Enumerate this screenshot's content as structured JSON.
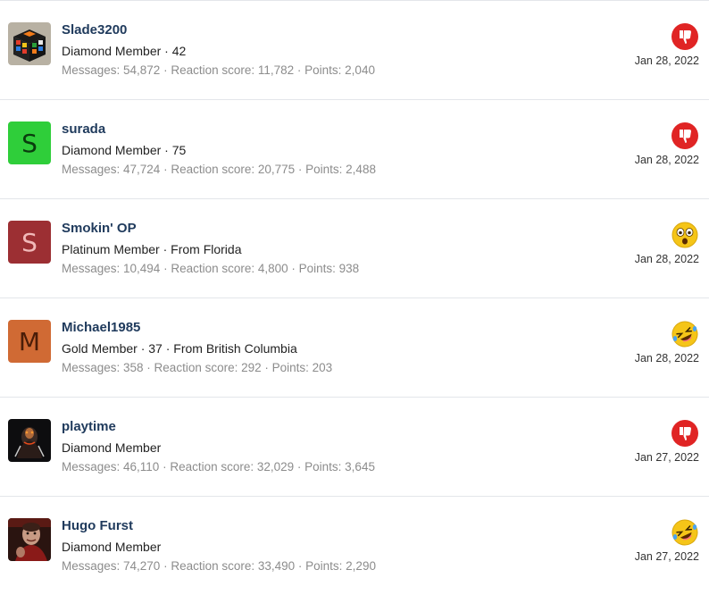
{
  "members": [
    {
      "name": "Slade3200",
      "title": "Diamond Member · 42",
      "stats": "Messages: 54,872 · Reaction score: 11,782 · Points: 2,040",
      "avatar": "rubiks-cube-image",
      "reaction": "thumbs-down-icon",
      "date": "Jan 28, 2022"
    },
    {
      "name": "surada",
      "title": "Diamond Member · 75",
      "stats": "Messages: 47,724 · Reaction score: 20,775 · Points: 2,488",
      "avatar_letter": "S",
      "avatar_color": "#2fce3a",
      "reaction": "thumbs-down-icon",
      "date": "Jan 28, 2022"
    },
    {
      "name": "Smokin' OP",
      "title": "Platinum Member · From Florida",
      "stats": "Messages: 10,494 · Reaction score: 4,800 · Points: 938",
      "avatar_letter": "S",
      "avatar_color": "#9c2f33",
      "reaction": "wow-face-icon",
      "date": "Jan 28, 2022"
    },
    {
      "name": "Michael1985",
      "title": "Gold Member · 37 · From British Columbia",
      "stats": "Messages: 358 · Reaction score: 292 · Points: 203",
      "avatar_letter": "M",
      "avatar_color": "#d06a34",
      "reaction": "laughing-face-icon",
      "date": "Jan 28, 2022"
    },
    {
      "name": "playtime",
      "title": "Diamond Member",
      "stats": "Messages: 46,110 · Reaction score: 32,029 · Points: 3,645",
      "avatar": "dark-figure-image",
      "reaction": "thumbs-down-icon",
      "date": "Jan 27, 2022"
    },
    {
      "name": "Hugo Furst",
      "title": "Diamond Member",
      "stats": "Messages: 74,270 · Reaction score: 33,490 · Points: 2,290",
      "avatar": "portrait-image",
      "reaction": "laughing-face-icon",
      "date": "Jan 27, 2022"
    }
  ],
  "colors": {
    "name": "#1f3a5c",
    "stats": "#8c8c8c",
    "thumbs_down": "#e02424",
    "emoji_yellow": "#f5c518"
  }
}
